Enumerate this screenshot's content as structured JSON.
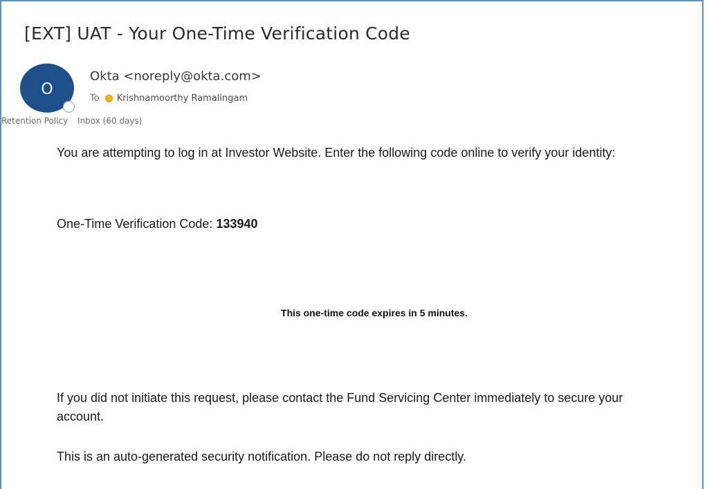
{
  "email": {
    "subject": "[EXT] UAT - Your One-Time Verification Code",
    "avatar_initial": "O",
    "sender": "Okta <noreply@okta.com>",
    "to_label": "To",
    "recipient": "Krishnamoorthy Ramalingam",
    "retention_label": "Retention Policy",
    "retention_value": "Inbox (60 days)"
  },
  "body": {
    "intro": "You are attempting to log in at Investor Website. Enter the following code online to verify your identity:",
    "code_label": "One-Time Verification Code: ",
    "code_value": "133940",
    "expiry_note": "This one-time code expires in 5 minutes.",
    "contact_note": "If you did not initiate this request, please contact the Fund Servicing Center immediately to secure your account.",
    "auto_note": "This is an auto-generated security notification. Please do not reply directly."
  },
  "colors": {
    "frame_border": "#5a8fc7",
    "avatar_bg": "#1f4f8a",
    "presence_dot": "#f2b01e"
  }
}
